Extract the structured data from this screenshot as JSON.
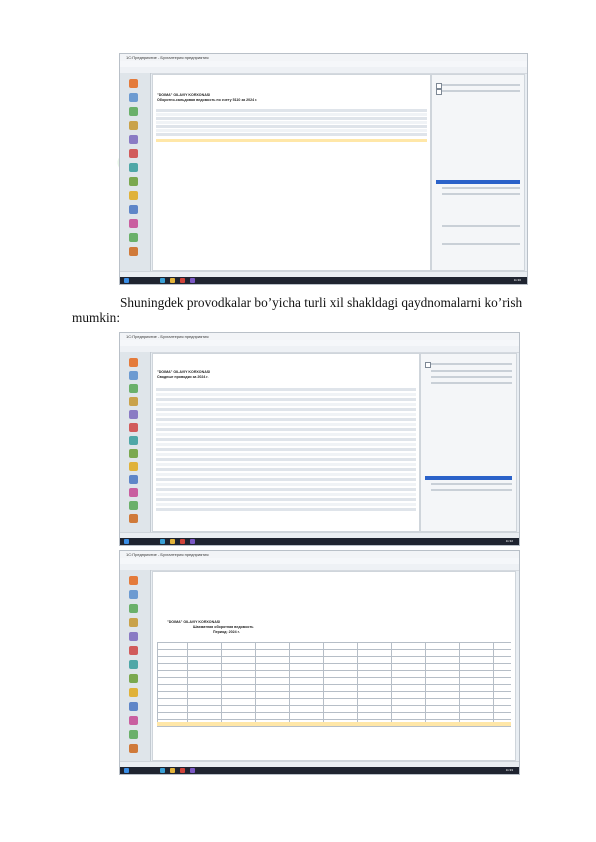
{
  "paragraph": {
    "line1": "Shuningdek provodkalar bo’yicha turli xil shakldagi qaydnomalarni ko’rish",
    "line2": "mumkin:"
  },
  "screenshots": [
    {
      "app_title": "1С:Предприятие - Бухгалтерия предприятия",
      "report_header": "\"DOIMA\" OILAVIY KORXONASI",
      "report_title": "Оборотно-сальдовая ведомость по счету 5110 за 2024 г.",
      "clock": "11:30"
    },
    {
      "app_title": "1С:Предприятие - Бухгалтерия предприятия",
      "report_header": "\"DOIMA\" OILAVIY KORXONASI",
      "report_title": "Сводные проводки за 2024 г.",
      "clock": "11:32"
    },
    {
      "app_title": "1С:Предприятие - Бухгалтерия предприятия",
      "report_header": "\"DOIMA\" OILAVIY KORXONASI",
      "report_title": "Шахматная оборотная ведомость",
      "report_subtitle": "Период: 2024 г.",
      "clock": "11:33"
    }
  ],
  "colors": {
    "highlight": "#ffe7a8",
    "selection": "#2a62c9",
    "taskbar": "#1f2430"
  }
}
